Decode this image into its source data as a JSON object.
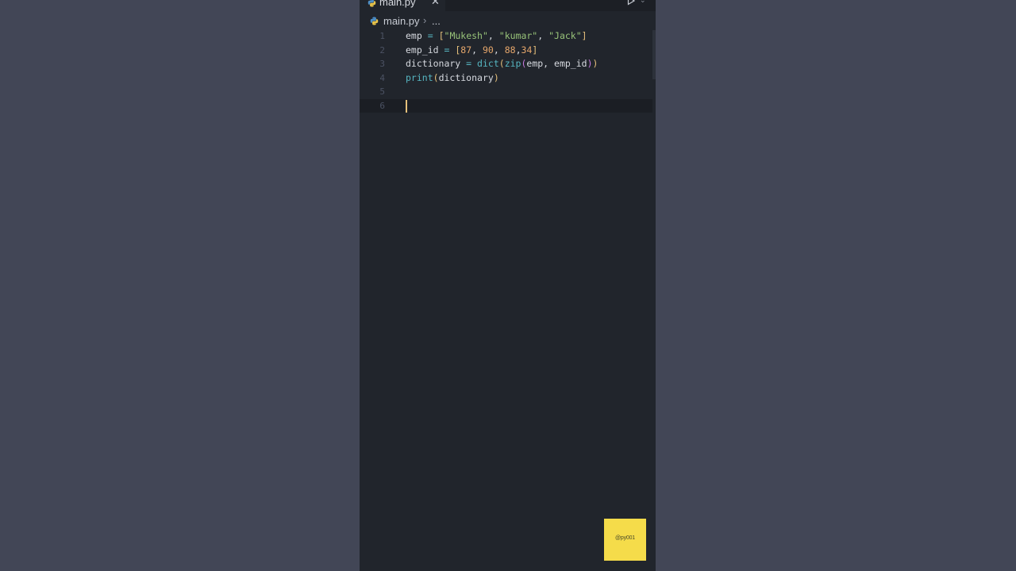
{
  "tab": {
    "filename": "main.py",
    "close_glyph": "✕",
    "icon": "python-file-icon"
  },
  "toolbar": {
    "run_icon": "play-icon",
    "run_chevron": "⌄"
  },
  "breadcrumb": {
    "file": "main.py",
    "separator": "›",
    "more": "..."
  },
  "editor": {
    "lines": [
      {
        "number": "1",
        "tokens": [
          {
            "t": "emp ",
            "c": "plain"
          },
          {
            "t": "=",
            "c": "op"
          },
          {
            "t": " ",
            "c": "plain"
          },
          {
            "t": "[",
            "c": "br1"
          },
          {
            "t": "\"Mukesh\"",
            "c": "str"
          },
          {
            "t": ", ",
            "c": "plain"
          },
          {
            "t": "\"kumar\"",
            "c": "str"
          },
          {
            "t": ", ",
            "c": "plain"
          },
          {
            "t": "\"Jack\"",
            "c": "str"
          },
          {
            "t": "]",
            "c": "br1"
          }
        ]
      },
      {
        "number": "2",
        "tokens": [
          {
            "t": "emp_id ",
            "c": "plain"
          },
          {
            "t": "=",
            "c": "op"
          },
          {
            "t": " ",
            "c": "plain"
          },
          {
            "t": "[",
            "c": "br1"
          },
          {
            "t": "87",
            "c": "num"
          },
          {
            "t": ", ",
            "c": "plain"
          },
          {
            "t": "90",
            "c": "num"
          },
          {
            "t": ", ",
            "c": "plain"
          },
          {
            "t": "88",
            "c": "num"
          },
          {
            "t": ",",
            "c": "plain"
          },
          {
            "t": "34",
            "c": "num"
          },
          {
            "t": "]",
            "c": "br1"
          }
        ]
      },
      {
        "number": "3",
        "tokens": [
          {
            "t": "dictionary ",
            "c": "plain"
          },
          {
            "t": "=",
            "c": "op"
          },
          {
            "t": " ",
            "c": "plain"
          },
          {
            "t": "dict",
            "c": "fn"
          },
          {
            "t": "(",
            "c": "br1"
          },
          {
            "t": "zip",
            "c": "fn"
          },
          {
            "t": "(",
            "c": "br2"
          },
          {
            "t": "emp, emp_id",
            "c": "plain"
          },
          {
            "t": ")",
            "c": "br2"
          },
          {
            "t": ")",
            "c": "br1"
          }
        ]
      },
      {
        "number": "4",
        "tokens": [
          {
            "t": "print",
            "c": "fn"
          },
          {
            "t": "(",
            "c": "br1"
          },
          {
            "t": "dictionary",
            "c": "plain"
          },
          {
            "t": ")",
            "c": "br1"
          }
        ]
      },
      {
        "number": "5",
        "tokens": []
      },
      {
        "number": "6",
        "tokens": [],
        "active": true
      }
    ]
  },
  "watermark": {
    "text": "@py001"
  },
  "colors": {
    "background": "#424656",
    "editor_bg": "#21252c",
    "string": "#98c379",
    "number": "#e5a66b",
    "function": "#56b6c2",
    "bracket": "#e5c07b",
    "watermark_bg": "#f5dc4a"
  }
}
